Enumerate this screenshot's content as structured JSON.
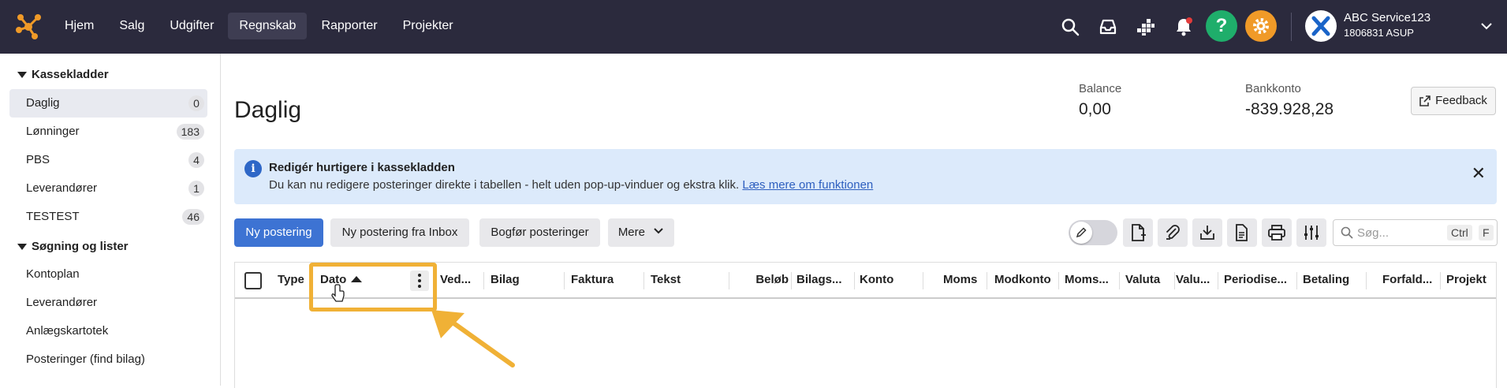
{
  "nav": {
    "items": [
      {
        "label": "Hjem",
        "active": false
      },
      {
        "label": "Salg",
        "active": false
      },
      {
        "label": "Udgifter",
        "active": false
      },
      {
        "label": "Regnskab",
        "active": true
      },
      {
        "label": "Rapporter",
        "active": false
      },
      {
        "label": "Projekter",
        "active": false
      }
    ],
    "company_name": "ABC Service123",
    "company_sub": "1806831 ASUP",
    "help_label": "?"
  },
  "sidebar": {
    "section1_title": "Kassekladder",
    "journals": [
      {
        "label": "Daglig",
        "count": "0",
        "active": true
      },
      {
        "label": "Lønninger",
        "count": "183",
        "active": false
      },
      {
        "label": "PBS",
        "count": "4",
        "active": false
      },
      {
        "label": "Leverandører",
        "count": "1",
        "active": false
      },
      {
        "label": "TESTEST",
        "count": "46",
        "active": false
      }
    ],
    "section2_title": "Søgning og lister",
    "lists": [
      {
        "label": "Kontoplan"
      },
      {
        "label": "Leverandører"
      },
      {
        "label": "Anlægskartotek"
      },
      {
        "label": "Posteringer (find bilag)"
      }
    ]
  },
  "main": {
    "title": "Daglig",
    "balance_label": "Balance",
    "balance_value": "0,00",
    "bank_label": "Bankkonto",
    "bank_value": "-839.928,28",
    "feedback_label": "Feedback"
  },
  "banner": {
    "title": "Redigér hurtigere i kassekladden",
    "body": "Du kan nu redigere posteringer direkte i tabellen - helt uden pop-up-vinduer og ekstra klik.",
    "link": "Læs mere om funktionen",
    "info_glyph": "i",
    "close_glyph": "✕"
  },
  "actions": {
    "new_entry": "Ny postering",
    "new_from_inbox": "Ny postering fra Inbox",
    "post_entries": "Bogfør posteringer",
    "more": "Mere"
  },
  "search": {
    "placeholder": "Søg...",
    "kbd1": "Ctrl",
    "kbd2": "F"
  },
  "table": {
    "columns": [
      {
        "label": "Type"
      },
      {
        "label": "Dato",
        "sorted": "asc"
      },
      {
        "label": "Ved..."
      },
      {
        "label": "Bilag"
      },
      {
        "label": "Faktura"
      },
      {
        "label": "Tekst"
      },
      {
        "label": "Beløb"
      },
      {
        "label": "Bilags..."
      },
      {
        "label": "Konto"
      },
      {
        "label": "Moms"
      },
      {
        "label": "Modkonto"
      },
      {
        "label": "Moms..."
      },
      {
        "label": "Valuta"
      },
      {
        "label": "Valu..."
      },
      {
        "label": "Periodise..."
      },
      {
        "label": "Betaling"
      },
      {
        "label": "Forfald..."
      },
      {
        "label": "Projekt"
      }
    ],
    "rows": []
  },
  "colors": {
    "topbar": "#2b2a3d",
    "primary": "#3d73d3",
    "help": "#1fae6b",
    "settings": "#f09a28",
    "highlight": "#f0b136",
    "banner_bg": "#dceafb"
  }
}
